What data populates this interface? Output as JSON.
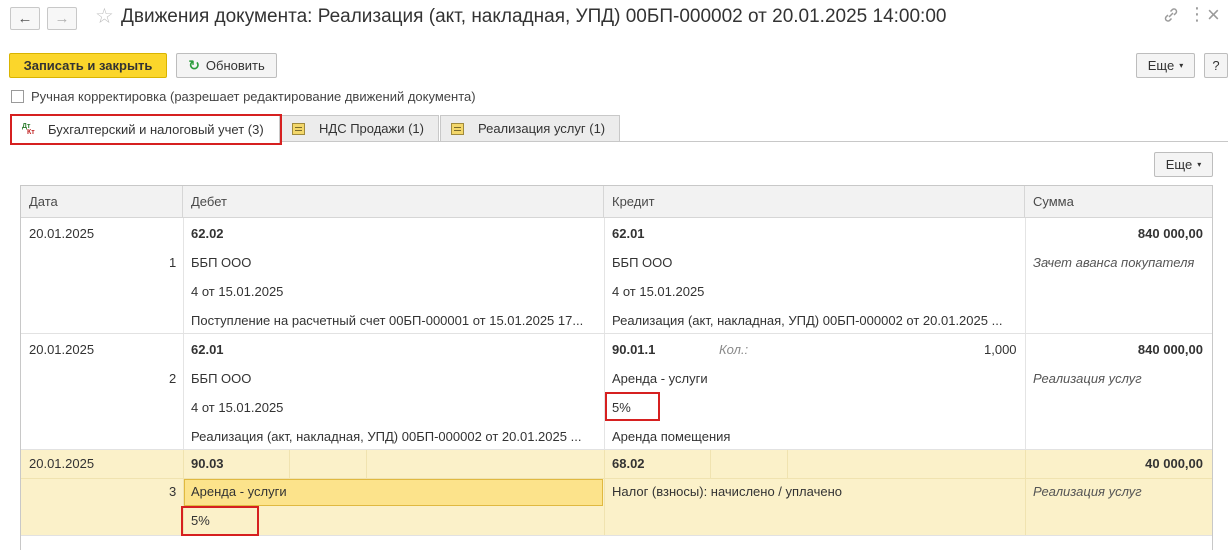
{
  "window": {
    "title": "Движения документа: Реализация (акт, накладная, УПД) 00БП-000002 от 20.01.2025 14:00:00",
    "back_icon": "←",
    "forward_icon": "→",
    "star_icon": "☆",
    "link_icon": "🔗",
    "menu_icon": "⋮",
    "close_icon": "×"
  },
  "toolbar": {
    "save_close": "Записать и закрыть",
    "refresh": "Обновить",
    "more": "Еще",
    "help": "?",
    "refresh_icon": "↻",
    "caret": "▾"
  },
  "manual_correction": {
    "checked": false,
    "label": "Ручная корректировка (разрешает редактирование движений документа)"
  },
  "tabs": [
    {
      "label": "Бухгалтерский и налоговый учет (3)",
      "icon": "dt-kt-icon",
      "icon_dt": "Дт",
      "icon_kt": "Кт",
      "active": true
    },
    {
      "label": "НДС Продажи (1)",
      "icon": "register-icon",
      "active": false
    },
    {
      "label": "Реализация услуг (1)",
      "icon": "register-icon",
      "active": false
    }
  ],
  "table_toolbar": {
    "more": "Еще"
  },
  "table": {
    "columns": [
      "Дата",
      "Дебет",
      "Кредит",
      "Сумма"
    ],
    "rows": [
      {
        "date": "20.01.2025",
        "num": "1",
        "debit_account": "62.02",
        "debit_sub1": "ББП ООО",
        "debit_sub2": "4 от 15.01.2025",
        "debit_sub3": "Поступление на расчетный счет 00БП-000001 от 15.01.2025 17...",
        "credit_account": "62.01",
        "credit_sub1": "ББП ООО",
        "credit_sub2": "4 от 15.01.2025",
        "credit_sub3": "Реализация (акт, накладная, УПД) 00БП-000002 от 20.01.2025 ...",
        "amount": "840 000,00",
        "content": "Зачет аванса покупателя"
      },
      {
        "date": "20.01.2025",
        "num": "2",
        "debit_account": "62.01",
        "debit_sub1": "ББП ООО",
        "debit_sub2": "4 от 15.01.2025",
        "debit_sub3": "Реализация (акт, накладная, УПД) 00БП-000002 от 20.01.2025 ...",
        "credit_account": "90.01.1",
        "credit_qty_label": "Кол.:",
        "credit_qty": "1,000",
        "credit_sub1": "Аренда - услуги",
        "credit_sub2": "5%",
        "credit_sub3": "Аренда помещения",
        "amount": "840 000,00",
        "content": "Реализация услуг"
      },
      {
        "date": "20.01.2025",
        "num": "3",
        "debit_account": "90.03",
        "debit_sub1": "Аренда - услуги",
        "debit_sub2": "5%",
        "credit_account": "68.02",
        "credit_sub1": "Налог (взносы): начислено / уплачено",
        "amount": "40 000,00",
        "content": "Реализация услуг",
        "selected": true
      }
    ]
  },
  "colors": {
    "primary_button": "#fbd62b",
    "selected_row": "#fbf1c9",
    "highlight_border": "#d62020"
  }
}
